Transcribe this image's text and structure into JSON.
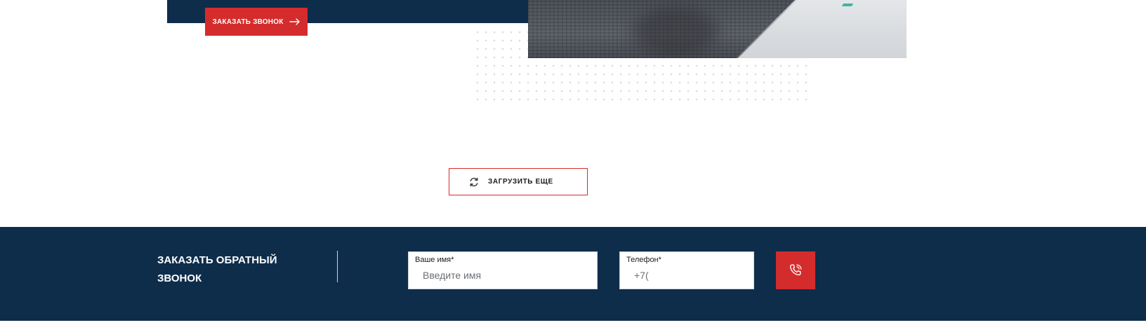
{
  "hero": {
    "cta_label": "ЗАКАЗАТЬ ЗВОНОК",
    "cta_icon": "arrow-right-icon"
  },
  "load_more": {
    "label": "ЗАГРУЗИТЬ ЕЩЕ",
    "icon": "refresh-icon"
  },
  "callback_form": {
    "title": "ЗАКАЗАТЬ ОБРАТНЫЙ ЗВОНОК",
    "name_label": "Ваше имя*",
    "name_placeholder": "Введите имя",
    "phone_label": "Телефон*",
    "phone_value": "+7(",
    "submit_icon": "phone-icon"
  },
  "colors": {
    "navy": "#0e2d4b",
    "accent_red": "#d42c2c",
    "dot_gray": "#d9dde3"
  }
}
